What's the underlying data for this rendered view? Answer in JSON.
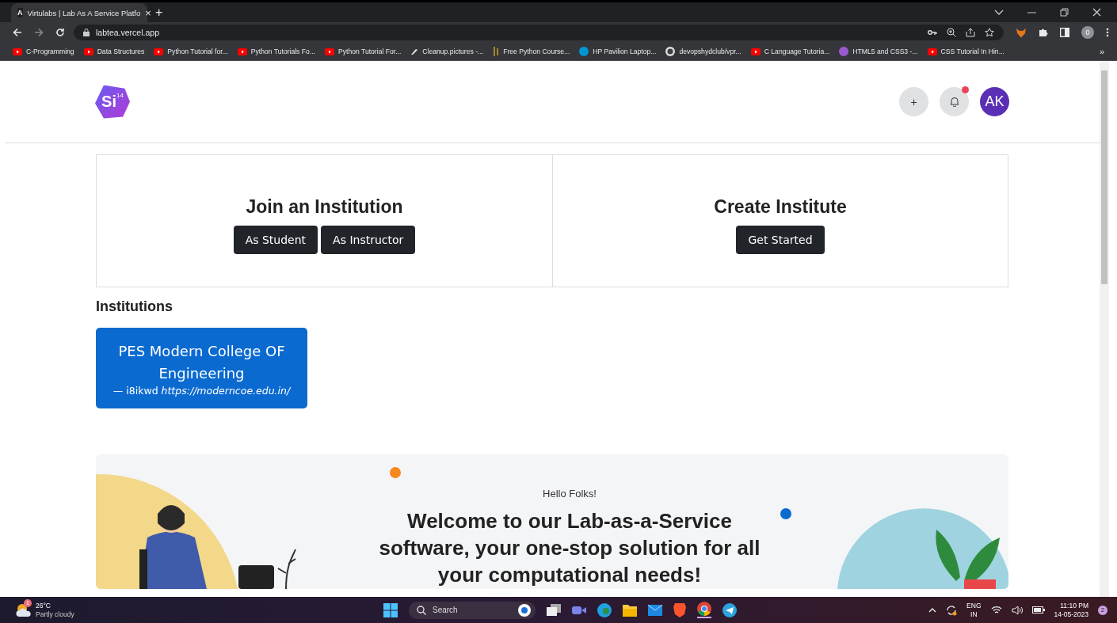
{
  "browser": {
    "tabs": [
      {
        "title": "Virtulabs | Lab As A Service Platfo",
        "icon_letter": "A",
        "close": "×",
        "selected": true
      }
    ],
    "new_tab": "+",
    "url": "labtea.vercel.app",
    "profile": "0",
    "bookmarks": [
      {
        "label": "C-Programming",
        "kind": "video"
      },
      {
        "label": "Data Structures",
        "kind": "video"
      },
      {
        "label": "Python Tutorial for...",
        "kind": "video"
      },
      {
        "label": "Python Tutorials Fo...",
        "kind": "video"
      },
      {
        "label": "Python Tutorial For...",
        "kind": "video"
      },
      {
        "label": "Cleanup.pictures -...",
        "kind": "brush"
      },
      {
        "label": "Free Python Course...",
        "kind": "bars"
      },
      {
        "label": "HP Pavilion Laptop...",
        "kind": "globe"
      },
      {
        "label": "devopshydclub/vpr...",
        "kind": "octocat"
      },
      {
        "label": "C Language Tutoria...",
        "kind": "video"
      },
      {
        "label": "HTML5 and CSS3 -...",
        "kind": "purple"
      },
      {
        "label": "CSS Tutorial In Hin...",
        "kind": "video"
      }
    ],
    "more": "»"
  },
  "header": {
    "logo": {
      "symbol": "Si",
      "number": "14"
    },
    "add": "+",
    "notification": true,
    "avatar": "AK"
  },
  "join": {
    "title": "Join an Institution",
    "buttons": [
      "As Student",
      "As Instructor"
    ]
  },
  "create": {
    "title": "Create Institute",
    "button": "Get Started"
  },
  "institutions": {
    "heading": "Institutions",
    "items": [
      {
        "name": "PES Modern College OF Engineering",
        "dash": "—",
        "code": "i8ikwd",
        "url": "https://moderncoe.edu.in/"
      }
    ]
  },
  "hero": {
    "greeting": "Hello Folks!",
    "headline": "Welcome to our Lab-as-a-Service software, your one-stop solution for all your computational needs!"
  },
  "taskbar": {
    "temperature": "26°C",
    "weather": "Partly cloudy",
    "weather_badge": "1",
    "search": "Search",
    "language": "ENG",
    "region": "IN",
    "time": "11:10 PM",
    "date": "14-05-2023",
    "notifications": "2"
  }
}
